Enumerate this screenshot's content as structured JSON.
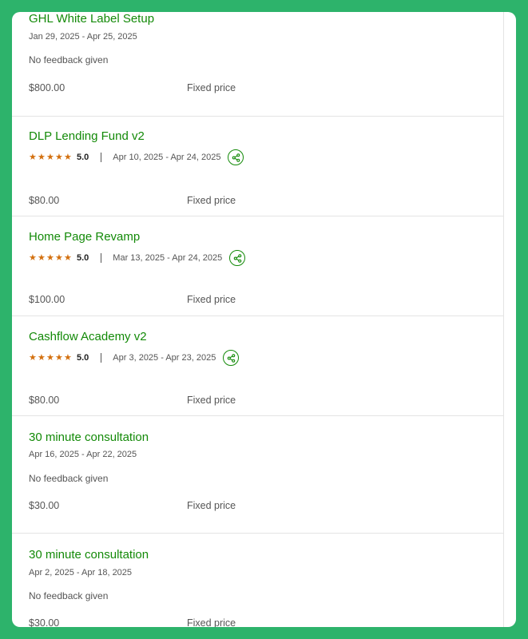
{
  "colors": {
    "frame": "#2db36b",
    "title": "#138a08",
    "star": "#d3700f",
    "text": "#555555"
  },
  "jobs": [
    {
      "title": "GHL White Label Setup",
      "dates": "Jan 29, 2025 - Apr 25, 2025",
      "feedback": "No feedback given",
      "amount": "$800.00",
      "price_type": "Fixed price"
    },
    {
      "title": "DLP Lending Fund v2",
      "rating": "5.0",
      "stars": 5,
      "dates": "Apr 10, 2025 - Apr 24, 2025",
      "share_icon": "share-icon",
      "amount": "$80.00",
      "price_type": "Fixed price"
    },
    {
      "title": "Home Page Revamp",
      "rating": "5.0",
      "stars": 5,
      "dates": "Mar 13, 2025 - Apr 24, 2025",
      "share_icon": "share-icon",
      "amount": "$100.00",
      "price_type": "Fixed price"
    },
    {
      "title": "Cashflow Academy v2",
      "rating": "5.0",
      "stars": 5,
      "dates": "Apr 3, 2025 - Apr 23, 2025",
      "share_icon": "share-icon",
      "amount": "$80.00",
      "price_type": "Fixed price"
    },
    {
      "title": "30 minute consultation",
      "dates": "Apr 16, 2025 - Apr 22, 2025",
      "feedback": "No feedback given",
      "amount": "$30.00",
      "price_type": "Fixed price"
    },
    {
      "title": "30 minute consultation",
      "dates": "Apr 2, 2025 - Apr 18, 2025",
      "feedback": "No feedback given",
      "amount": "$30.00",
      "price_type": "Fixed price"
    }
  ]
}
